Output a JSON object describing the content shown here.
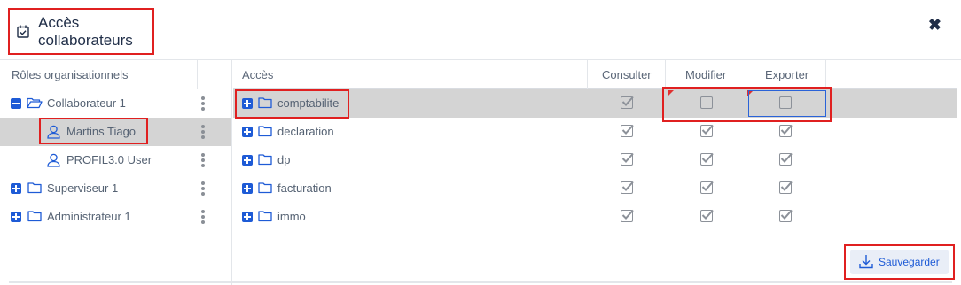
{
  "dialog": {
    "title": "Accès collaborateurs",
    "close_icon": "close-x-icon"
  },
  "left_panel": {
    "header": "Rôles organisationnels",
    "items": [
      {
        "label": "Collaborateur 1",
        "icon": "folder-open-icon",
        "expander": "minus",
        "level": 0
      },
      {
        "label": "Martins Tiago",
        "icon": "user-icon",
        "level": 1,
        "selected": true
      },
      {
        "label": "PROFIL3.0 User",
        "icon": "user-icon",
        "level": 1
      },
      {
        "label": "Superviseur 1",
        "icon": "folder-icon",
        "expander": "plus",
        "level": 0
      },
      {
        "label": "Administrateur 1",
        "icon": "folder-icon",
        "expander": "plus",
        "level": 0
      }
    ]
  },
  "grid": {
    "columns": [
      "Accès",
      "Consulter",
      "Modifier",
      "Exporter"
    ],
    "rows": [
      {
        "name": "comptabilite",
        "consulter": true,
        "modifier": false,
        "exporter": false,
        "selected": true
      },
      {
        "name": "declaration",
        "consulter": true,
        "modifier": true,
        "exporter": true
      },
      {
        "name": "dp",
        "consulter": true,
        "modifier": true,
        "exporter": true
      },
      {
        "name": "facturation",
        "consulter": true,
        "modifier": true,
        "exporter": true
      },
      {
        "name": "immo",
        "consulter": true,
        "modifier": true,
        "exporter": true
      }
    ]
  },
  "footer": {
    "save_label": "Sauvegarder",
    "save_icon": "download-icon"
  },
  "colors": {
    "accent": "#1e5bd6",
    "highlight_border": "#e02020",
    "selected_row": "#d4d4d4"
  }
}
